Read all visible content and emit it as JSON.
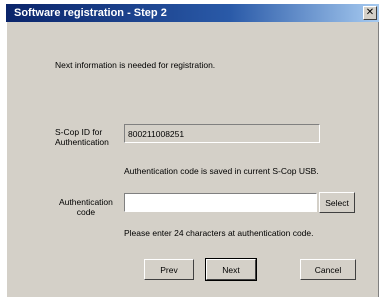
{
  "window": {
    "title": "Software registration - Step 2"
  },
  "intro": "Next information is needed for registration.",
  "scop_id": {
    "label_line1": "S-Cop ID for",
    "label_line2": "Authentication",
    "value": "800211008251",
    "note": "Authentication code is saved in current S-Cop USB."
  },
  "auth_code": {
    "label_line1": "Authentication",
    "label_line2": "code",
    "value": "",
    "select_label": "Select",
    "note": "Please enter 24 characters at authentication code."
  },
  "buttons": {
    "prev": "Prev",
    "next": "Next",
    "cancel": "Cancel"
  }
}
